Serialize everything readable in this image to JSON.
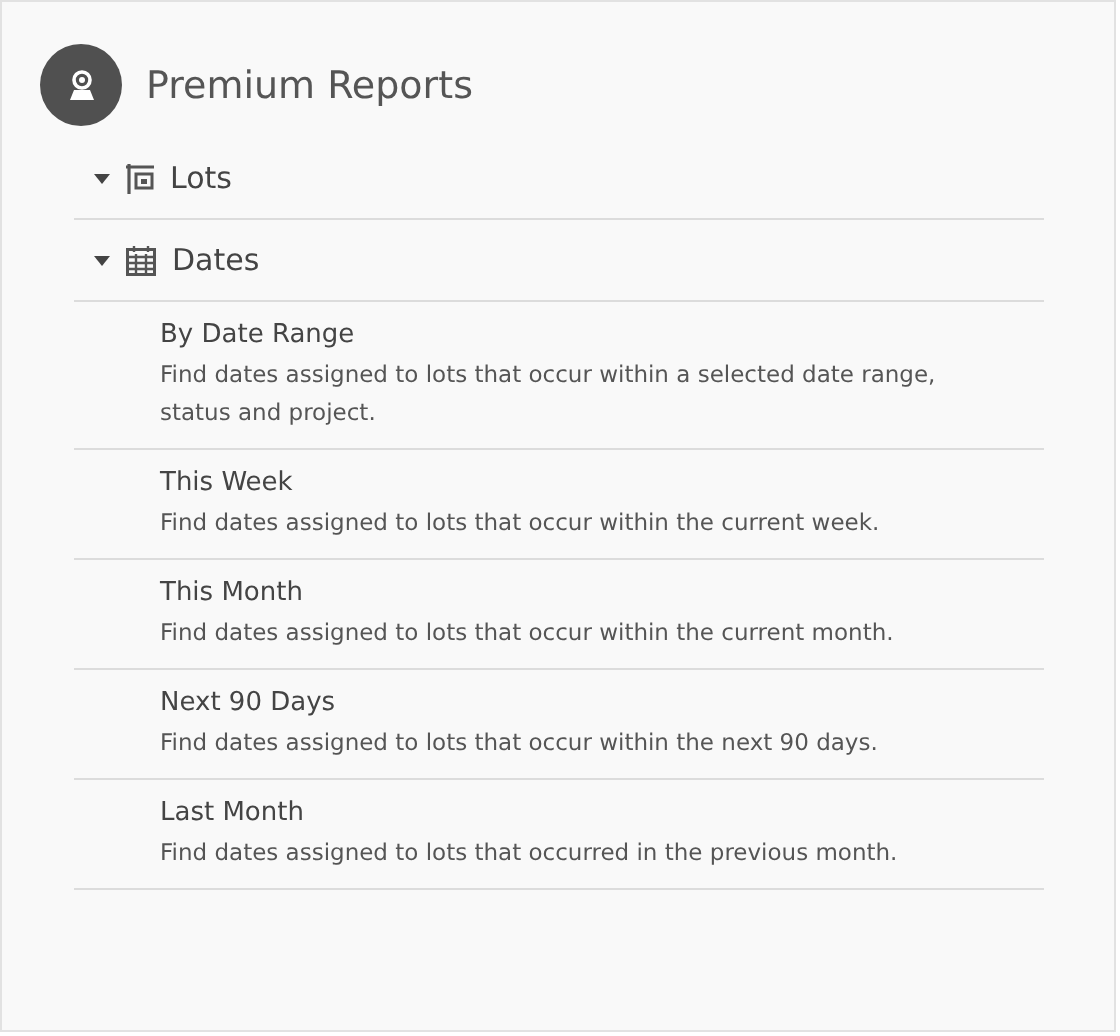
{
  "header": {
    "title": "Premium Reports"
  },
  "sections": [
    {
      "label": "Lots",
      "expanded": true
    },
    {
      "label": "Dates",
      "expanded": true,
      "reports": [
        {
          "title": "By Date Range",
          "description": "Find dates assigned to lots that occur within a selected date range, status and project."
        },
        {
          "title": "This Week",
          "description": "Find dates assigned to lots that occur within the current week."
        },
        {
          "title": "This Month",
          "description": "Find dates assigned to lots that occur within the current month."
        },
        {
          "title": "Next 90 Days",
          "description": "Find dates assigned to lots that occur within the next 90 days."
        },
        {
          "title": "Last Month",
          "description": "Find dates assigned to lots that occurred in the previous month."
        }
      ]
    }
  ]
}
